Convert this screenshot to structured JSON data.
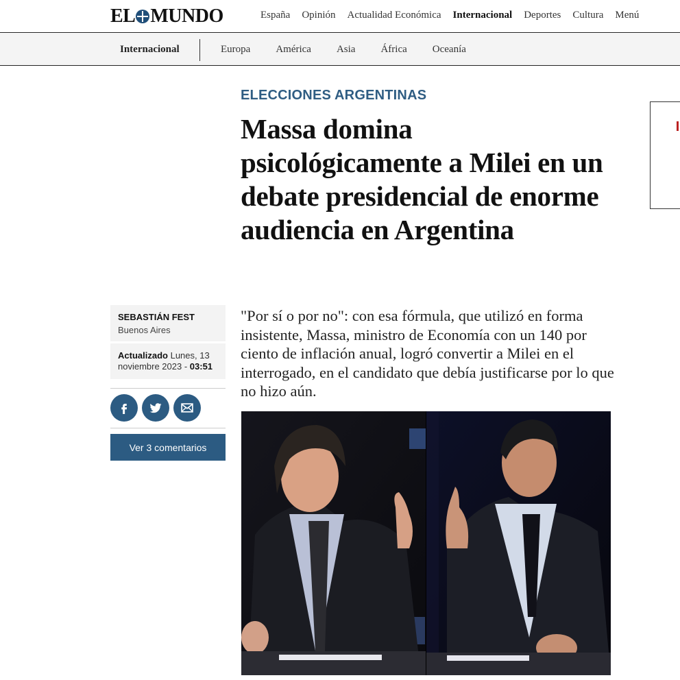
{
  "header": {
    "logo_text": "EL MUNDO",
    "nav": [
      {
        "label": "España",
        "active": false
      },
      {
        "label": "Opinión",
        "active": false
      },
      {
        "label": "Actualidad Económica",
        "active": false
      },
      {
        "label": "Internacional",
        "active": true
      },
      {
        "label": "Deportes",
        "active": false
      },
      {
        "label": "Cultura",
        "active": false
      },
      {
        "label": "Menú",
        "active": false
      }
    ]
  },
  "subnav": {
    "section": "Internacional",
    "items": [
      "Europa",
      "América",
      "Asia",
      "África",
      "Oceanía"
    ]
  },
  "article": {
    "kicker": "ELECCIONES ARGENTINAS",
    "headline": "Massa domina psicológicamente a Milei en un debate presidencial de enorme audiencia en Argentina",
    "author": "SEBASTIÁN FEST",
    "location": "Buenos Aires",
    "updated_label": "Actualizado",
    "updated_date": "Lunes, 13 noviembre 2023 - ",
    "updated_time": "03:51",
    "comments_label": "Ver 3 comentarios",
    "lede": "\"Por sí o por no\": con esa fórmula, que utilizó en forma insistente, Massa, ministro de Economía con un 140 por ciento de inflación anual, logró convertir a Milei en el interrogado, en el candidato que debía justificarse por lo que no hizo aún."
  },
  "share": {
    "icons": [
      "facebook-icon",
      "twitter-icon",
      "email-icon"
    ]
  },
  "colors": {
    "accent": "#2c5b82",
    "kicker": "#2f5d83",
    "ad_mark": "#bb2222"
  }
}
